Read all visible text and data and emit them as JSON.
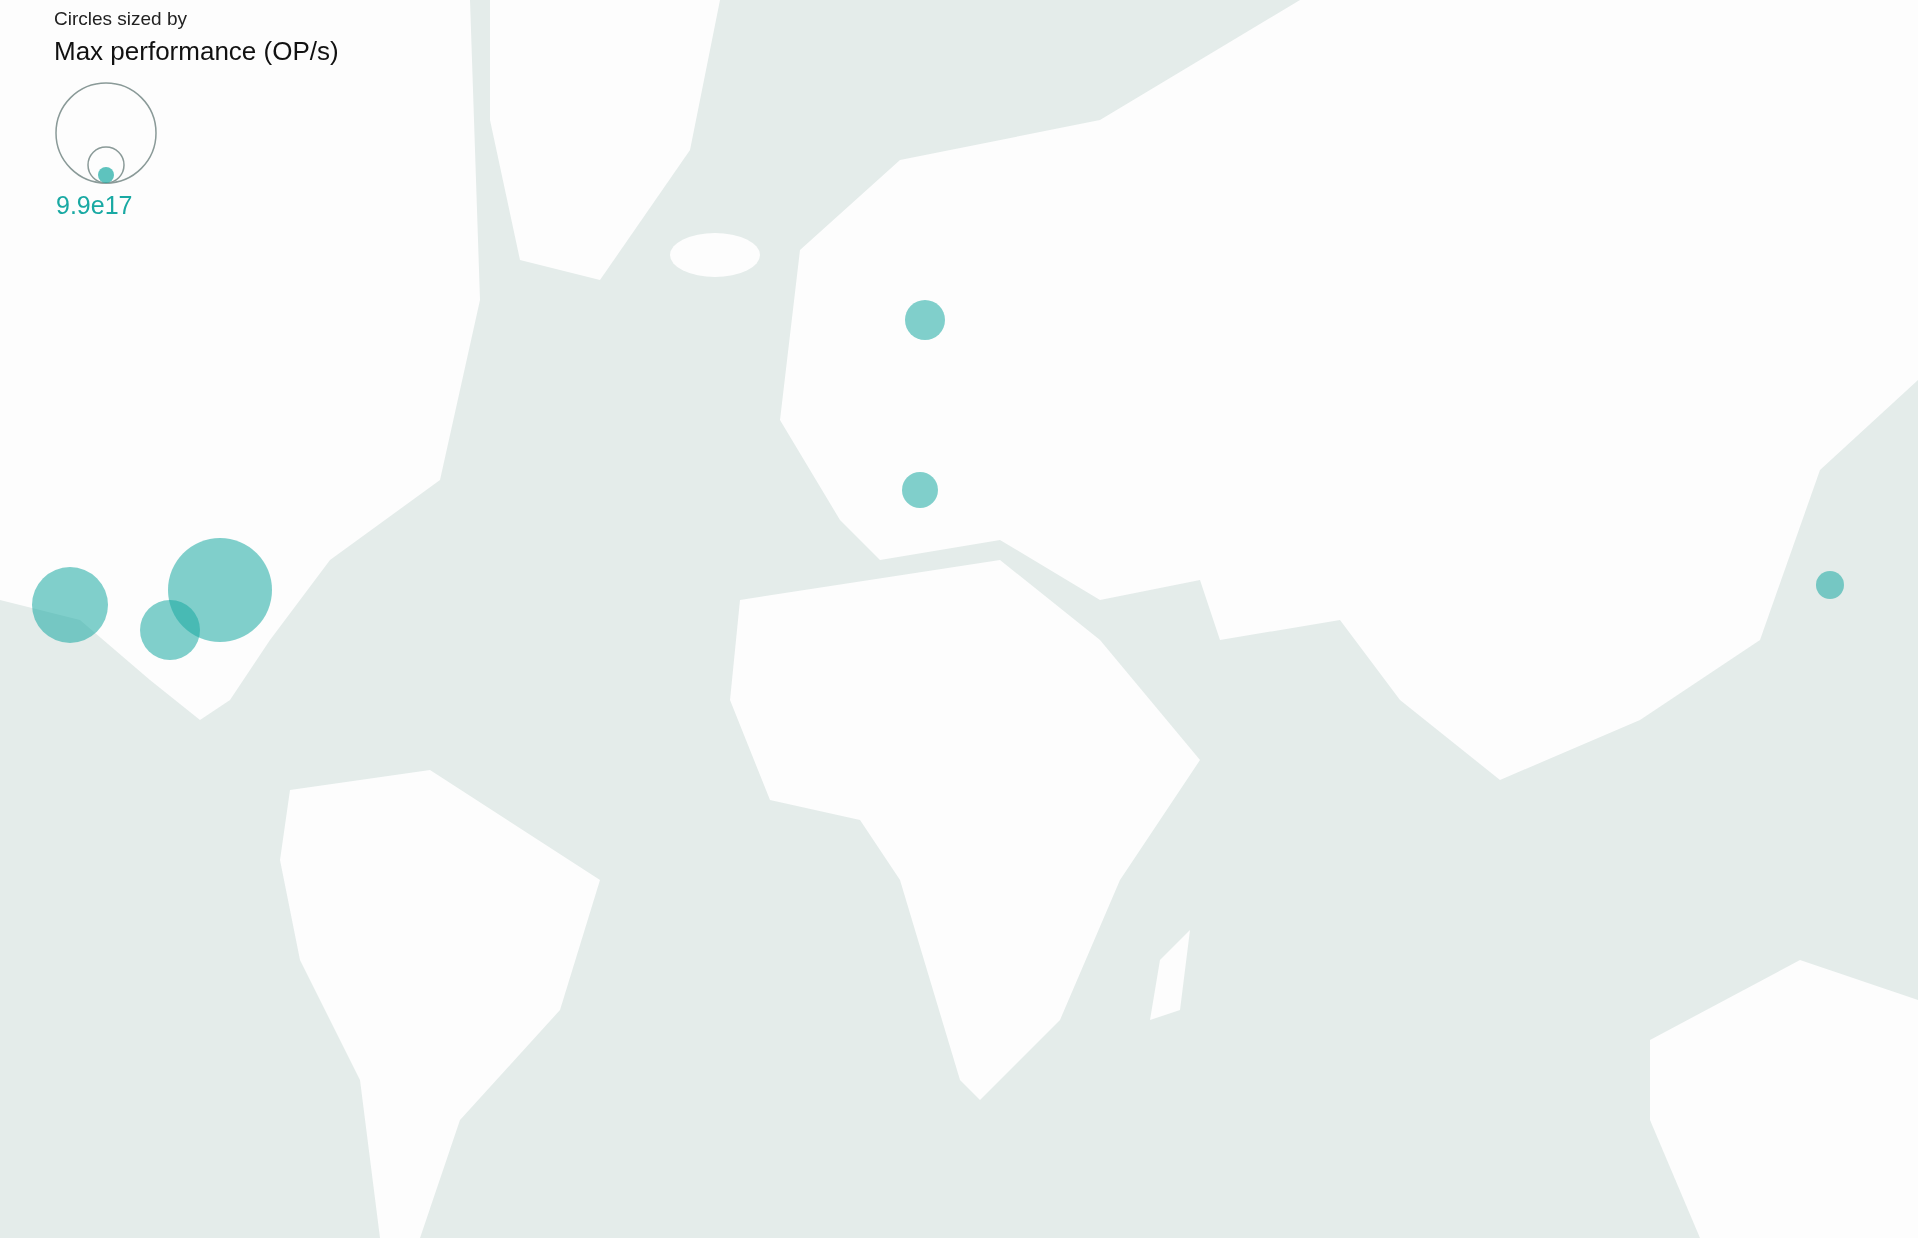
{
  "legend": {
    "caption": "Circles sized by",
    "title": "Max performance (OP/s)",
    "max_value": "9.9e17"
  }
}
